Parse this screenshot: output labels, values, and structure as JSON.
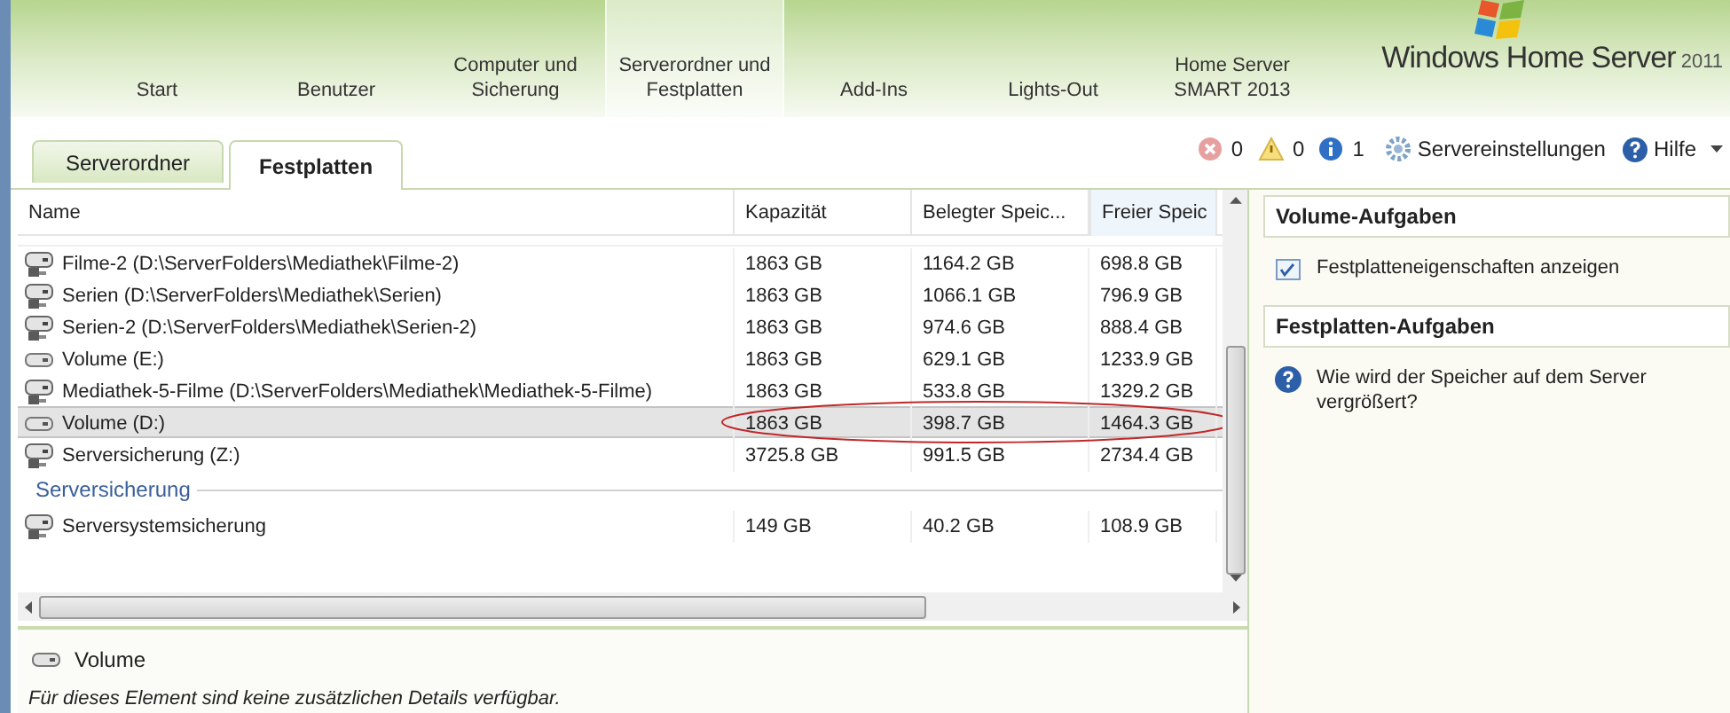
{
  "nav": [
    {
      "label": "Start",
      "selected": false
    },
    {
      "label": "Benutzer",
      "selected": false
    },
    {
      "label": "Computer und Sicherung",
      "selected": false
    },
    {
      "label": "Serverordner und Festplatten",
      "selected": true
    },
    {
      "label": "Add-Ins",
      "selected": false
    },
    {
      "label": "Lights-Out",
      "selected": false
    },
    {
      "label": "Home Server SMART 2013",
      "selected": false
    }
  ],
  "logo": {
    "name": "Windows Home Server",
    "version": "2011"
  },
  "tabs": [
    {
      "label": "Serverordner",
      "selected": false
    },
    {
      "label": "Festplatten",
      "selected": true
    }
  ],
  "status": {
    "errors": "0",
    "warnings": "0",
    "info": "1",
    "settings": "Servereinstellungen",
    "help": "Hilfe"
  },
  "table": {
    "columns": [
      "Name",
      "Kapazität",
      "Belegter Speic...",
      "Freier Speic"
    ],
    "rows": [
      {
        "kind": "folder",
        "cells": [
          "Filme-2 (D:\\ServerFolders\\Mediathek\\Filme-2)",
          "1863 GB",
          "1164.2 GB",
          "698.8 GB"
        ],
        "selected": false
      },
      {
        "kind": "folder",
        "cells": [
          "Serien (D:\\ServerFolders\\Mediathek\\Serien)",
          "1863 GB",
          "1066.1 GB",
          "796.9 GB"
        ],
        "selected": false
      },
      {
        "kind": "folder",
        "cells": [
          "Serien-2 (D:\\ServerFolders\\Mediathek\\Serien-2)",
          "1863 GB",
          "974.6 GB",
          "888.4 GB"
        ],
        "selected": false
      },
      {
        "kind": "volume",
        "cells": [
          "Volume (E:)",
          "1863 GB",
          "629.1 GB",
          "1233.9 GB"
        ],
        "selected": false
      },
      {
        "kind": "folder",
        "cells": [
          "Mediathek-5-Filme (D:\\ServerFolders\\Mediathek\\Mediathek-5-Filme)",
          "1863 GB",
          "533.8 GB",
          "1329.2 GB"
        ],
        "selected": false
      },
      {
        "kind": "volume",
        "cells": [
          "Volume (D:)",
          "1863 GB",
          "398.7 GB",
          "1464.3 GB"
        ],
        "selected": true
      },
      {
        "kind": "folder",
        "cells": [
          "Serversicherung (Z:)",
          "3725.8 GB",
          "991.5 GB",
          "2734.4 GB"
        ],
        "selected": false
      },
      {
        "kind": "group",
        "cells": [
          "Serversicherung"
        ]
      },
      {
        "kind": "folder",
        "cells": [
          "Serversystemsicherung",
          "149 GB",
          "40.2 GB",
          "108.9 GB"
        ],
        "selected": false
      }
    ]
  },
  "details": {
    "title": "Volume",
    "text": "Für dieses Element sind keine zusätzlichen Details verfügbar."
  },
  "tasks": [
    {
      "heading": "Volume-Aufgaben",
      "items": [
        {
          "kind": "properties",
          "label": "Festplatteneigenschaften anzeigen"
        }
      ]
    },
    {
      "heading": "Festplatten-Aufgaben",
      "items": [
        {
          "kind": "help",
          "label": "Wie wird der Speicher auf dem Server vergrößert?"
        }
      ]
    }
  ]
}
